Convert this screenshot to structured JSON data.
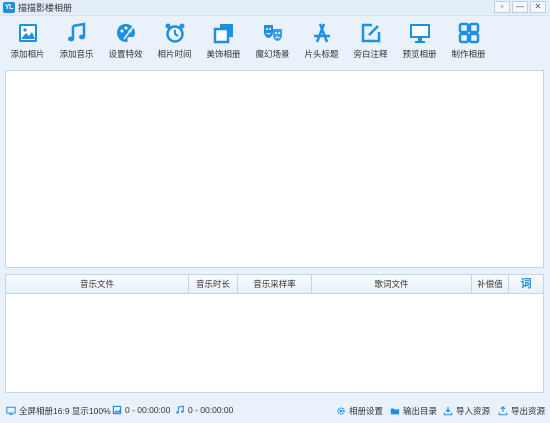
{
  "app": {
    "logo": "YL",
    "title": "描描影楼相册",
    "controls": [
      "▫",
      "—",
      "✕"
    ]
  },
  "toolbar": [
    {
      "label": "添加相片",
      "icon": "image-icon"
    },
    {
      "label": "添加音乐",
      "icon": "music-note-icon"
    },
    {
      "label": "设置特效",
      "icon": "palette-icon"
    },
    {
      "label": "相片时间",
      "icon": "alarm-clock-icon"
    },
    {
      "label": "美饰相册",
      "icon": "layers-icon"
    },
    {
      "label": "魔幻场景",
      "icon": "theater-masks-icon"
    },
    {
      "label": "片头标题",
      "icon": "app-store-icon"
    },
    {
      "label": "旁白注释",
      "icon": "edit-icon"
    },
    {
      "label": "预览相册",
      "icon": "monitor-icon"
    },
    {
      "label": "制作相册",
      "icon": "grid-icon"
    }
  ],
  "music_table": {
    "columns": [
      "音乐文件",
      "音乐时长",
      "音乐采样率",
      "歌词文件",
      "补偿值",
      "词"
    ]
  },
  "status": {
    "screen_mode": "全屏相册16:9 显示100%",
    "photo_count": "0 - 00:00:00",
    "music_count": "0 - 00:00:00",
    "album_settings": "相册设置",
    "output_dir": "输出目录",
    "import": "导入资源",
    "export": "导出资源"
  },
  "colors": {
    "accent": "#1f8fe0",
    "background": "#e9f2fb"
  }
}
